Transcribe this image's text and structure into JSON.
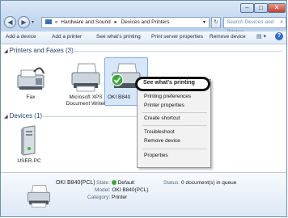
{
  "window": {
    "min_glyph": "–",
    "max_glyph": "□",
    "close_glyph": "✕"
  },
  "nav": {
    "back_glyph": "◀",
    "forward_glyph": "▶",
    "address_prefix": "«",
    "breadcrumb": [
      "Hardware and Sound",
      "Devices and Printers"
    ],
    "breadcrumb_sep": "▸",
    "refresh_glyph": "↻",
    "search_placeholder": "Search Devices and Printers",
    "search_glyph": "⌕"
  },
  "toolbar": {
    "items": [
      "Add a device",
      "Add a printer",
      "See what's printing",
      "Print server properties",
      "Remove device"
    ],
    "view_glyph": "▤ ▾",
    "help_glyph": "?"
  },
  "groups": {
    "printers_header": "Printers and Faxes (3)",
    "devices_header": "Devices (1)",
    "expand_glyph": "◢"
  },
  "printers": [
    {
      "label_lines": [
        "Fax"
      ]
    },
    {
      "label_lines": [
        "Microsoft XPS",
        "Document Writer"
      ]
    },
    {
      "label_lines": [
        "OKI B840"
      ]
    }
  ],
  "devices": [
    {
      "label_lines": [
        "USER-PC"
      ]
    }
  ],
  "context_menu": {
    "items": [
      {
        "label": "See what's printing",
        "bold": true
      },
      {
        "label": "Printing preferences"
      },
      {
        "label": "Printer properties"
      },
      {
        "label": "Create shortcut"
      },
      {
        "label": "Troubleshoot"
      },
      {
        "label": "Remove device"
      },
      {
        "label": "Properties"
      }
    ]
  },
  "details": {
    "name": "OKI B840(PCL)",
    "state_label": "State:",
    "state_value": "Default",
    "model_label": "Model:",
    "model_value": "OKI B840(PCL)",
    "category_label": "Category:",
    "category_value": "Printer",
    "status_label": "Status:",
    "status_value": "0 document(s) in queue"
  },
  "colors": {
    "accent": "#1f3d6b",
    "default_check": "#3da83b",
    "selection": "#d6e7fa"
  }
}
